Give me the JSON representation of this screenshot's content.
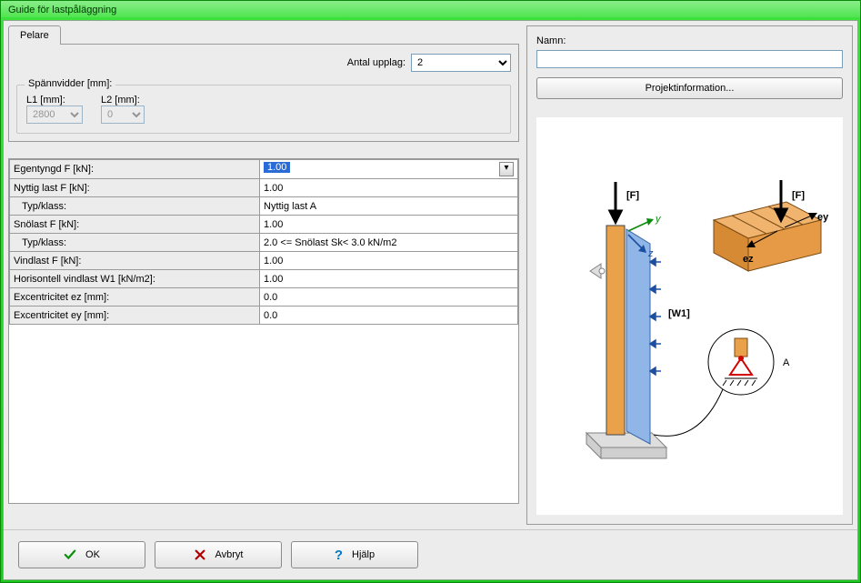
{
  "window": {
    "title": "Guide för lastpåläggning"
  },
  "tab": {
    "label": "Pelare"
  },
  "antal": {
    "label": "Antal upplag:",
    "value": "2"
  },
  "span": {
    "group": "Spännvidder [mm]:",
    "l1_label": "L1 [mm]:",
    "l1_value": "2800",
    "l2_label": "L2 [mm]:",
    "l2_value": "0"
  },
  "props": [
    {
      "key": "Egentyngd F [kN]:",
      "value": "1.00",
      "editing": true
    },
    {
      "key": "Nyttig last F [kN]:",
      "value": "1.00"
    },
    {
      "key": "   Typ/klass:",
      "value": "Nyttig last A"
    },
    {
      "key": "Snölast F [kN]:",
      "value": "1.00"
    },
    {
      "key": "   Typ/klass:",
      "value": "2.0 <= Snölast Sk< 3.0 kN/m2"
    },
    {
      "key": "Vindlast F [kN]:",
      "value": "1.00"
    },
    {
      "key": "Horisontell vindlast W1 [kN/m2]:",
      "value": "1.00"
    },
    {
      "key": "Excentricitet ez [mm]:",
      "value": "0.0"
    },
    {
      "key": "Excentricitet ey [mm]:",
      "value": "0.0"
    }
  ],
  "right": {
    "name_label": "Namn:",
    "name_value": "",
    "projinfo_label": "Projektinformation..."
  },
  "diagram": {
    "force_label": "[F]",
    "wind_label": "[W1]",
    "axis_y": "y",
    "axis_z": "z",
    "ecc_y": "ey",
    "ecc_z": "ez",
    "detail": "A"
  },
  "buttons": {
    "ok": "OK",
    "cancel": "Avbryt",
    "help": "Hjälp"
  }
}
